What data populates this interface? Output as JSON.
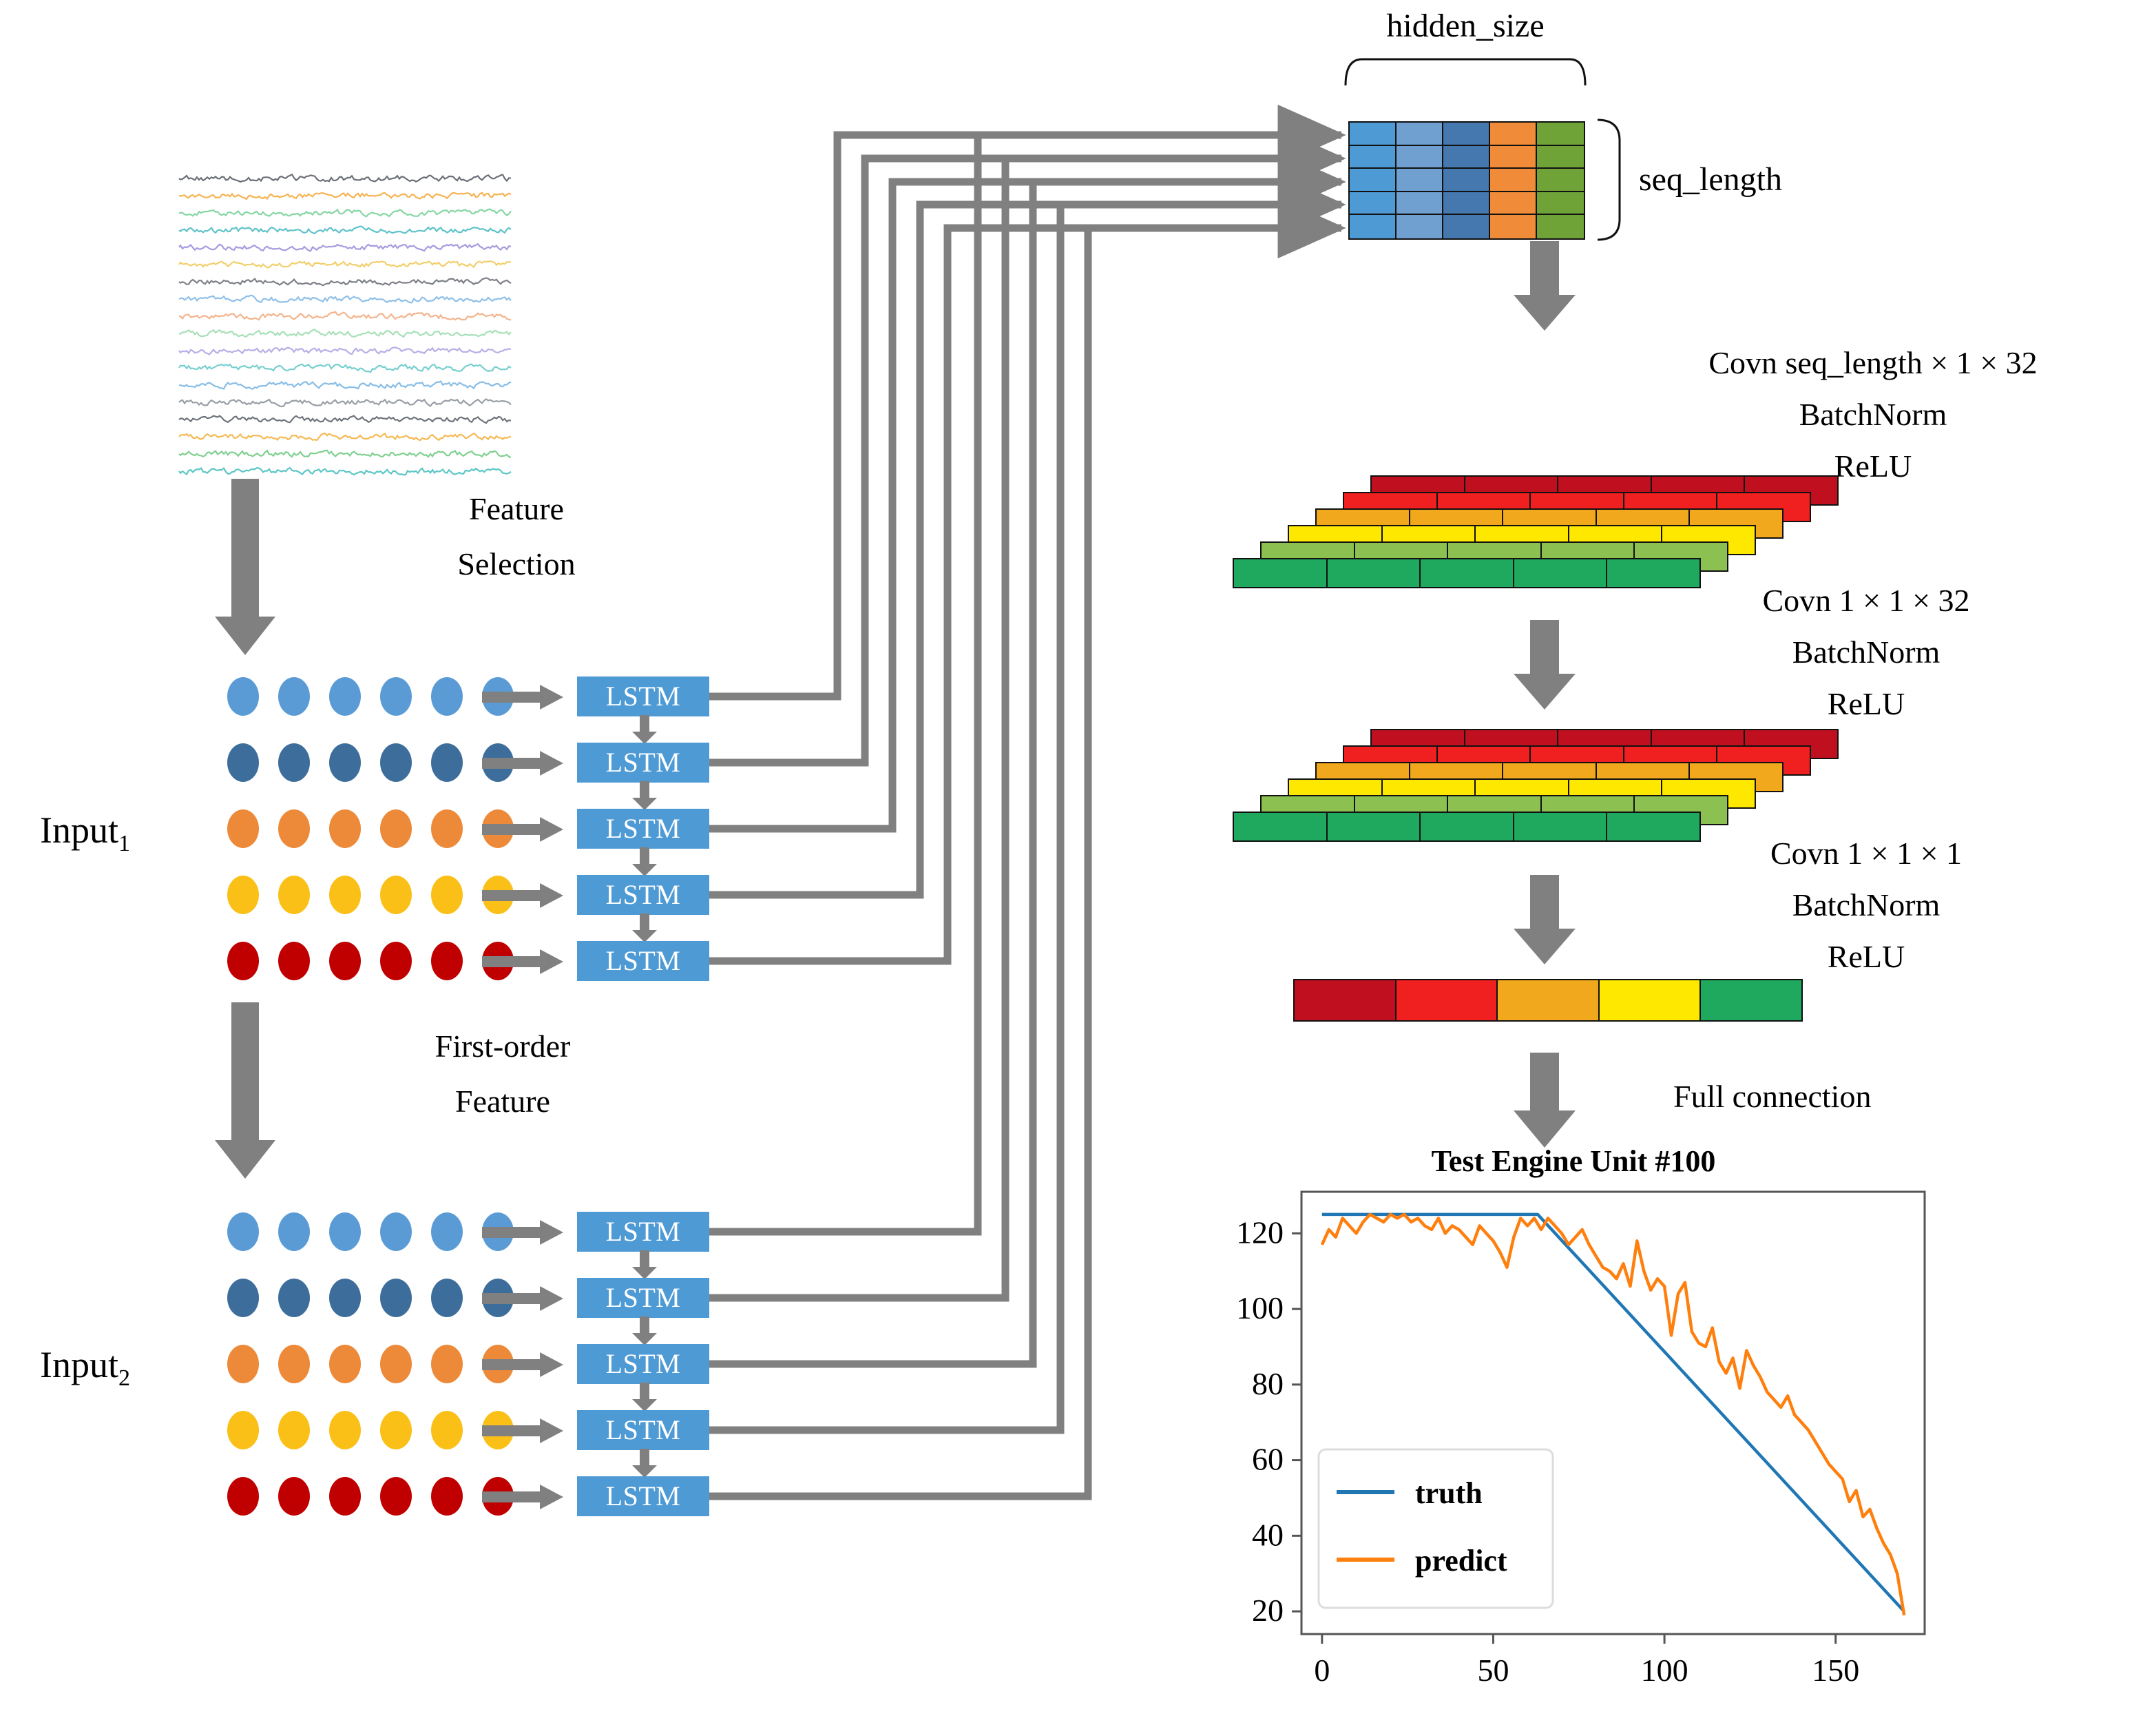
{
  "labels": {
    "hidden_size": "hidden_size",
    "seq_length": "seq_length",
    "feature_selection_l1": "Feature",
    "feature_selection_l2": "Selection",
    "first_order_l1": "First-order",
    "first_order_l2": "Feature",
    "input1": "Input",
    "input1_sub": "1",
    "input2": "Input",
    "input2_sub": "2",
    "lstm": "LSTM",
    "full_connection": "Full connection"
  },
  "blocks": {
    "conv1": {
      "line1": "Covn seq_length × 1  × 32",
      "line2": "BatchNorm",
      "line3": "ReLU"
    },
    "conv2": {
      "line1": "Covn 1 × 1 × 32",
      "line2": "BatchNorm",
      "line3": "ReLU"
    },
    "conv3": {
      "line1": "Covn 1 × 1 × 1",
      "line2": "BatchNorm",
      "line3": "ReLU"
    }
  },
  "colors": {
    "lstm_fill": "#4E9AD5",
    "arrow_gray": "#808080",
    "matrix_columns": [
      "#4E9AD5",
      "#6FA0D0",
      "#4478AE",
      "#F08C39",
      "#6FA338"
    ],
    "dot_rows": [
      "#5B9BD5",
      "#3D6E9B",
      "#ED8A3A",
      "#FBC018",
      "#C00000"
    ],
    "stack_layers": [
      "#1FA95E",
      "#8CC152",
      "#FFE800",
      "#F2A81D",
      "#F02020",
      "#C01020"
    ],
    "final_vector": [
      "#C01020",
      "#F02020",
      "#F2A81D",
      "#FFE800",
      "#1FA95E"
    ],
    "truth_line": "#2077B4",
    "predict_line": "#FF7F0E"
  },
  "matrix": {
    "rows": 5,
    "cols": 5
  },
  "stacks": {
    "layers": 6,
    "cells_per_layer": 5
  },
  "chart_data": {
    "type": "line",
    "title": "Test Engine Unit #100",
    "xlabel": "",
    "ylabel": "",
    "xlim": [
      -6,
      176
    ],
    "ylim": [
      14,
      131
    ],
    "xticks": [
      0,
      50,
      100,
      150
    ],
    "yticks": [
      20,
      40,
      60,
      80,
      100,
      120
    ],
    "grid": false,
    "legend_position": "lower left",
    "legend": [
      "truth",
      "predict"
    ],
    "series": [
      {
        "name": "truth",
        "color": "#2077B4",
        "x": [
          0,
          63,
          170
        ],
        "y": [
          125,
          125,
          20
        ]
      },
      {
        "name": "predict",
        "color": "#FF7F0E",
        "x": [
          0,
          2,
          4,
          6,
          8,
          10,
          12,
          14,
          16,
          18,
          20,
          22,
          24,
          26,
          28,
          30,
          32,
          34,
          36,
          38,
          40,
          42,
          44,
          46,
          48,
          50,
          52,
          54,
          56,
          58,
          60,
          62,
          64,
          66,
          68,
          70,
          72,
          74,
          76,
          78,
          80,
          82,
          84,
          86,
          88,
          90,
          92,
          94,
          96,
          98,
          100,
          102,
          104,
          106,
          108,
          110,
          112,
          114,
          116,
          118,
          120,
          122,
          124,
          126,
          128,
          130,
          132,
          134,
          136,
          138,
          140,
          142,
          144,
          146,
          148,
          150,
          152,
          154,
          156,
          158,
          160,
          162,
          164,
          166,
          168,
          170
        ],
        "y": [
          117,
          121,
          119,
          124,
          122,
          120,
          123,
          125,
          124,
          123,
          125,
          124,
          125,
          123,
          124,
          122,
          121,
          124,
          120,
          122,
          121,
          119,
          117,
          122,
          120,
          118,
          115,
          111,
          119,
          124,
          122,
          124,
          121,
          124,
          122,
          120,
          117,
          119,
          121,
          117,
          114,
          111,
          110,
          108,
          112,
          106,
          118,
          110,
          105,
          108,
          106,
          93,
          104,
          107,
          94,
          91,
          90,
          95,
          86,
          83,
          87,
          79,
          89,
          85,
          82,
          78,
          76,
          74,
          77,
          72,
          70,
          68,
          65,
          62,
          59,
          57,
          55,
          49,
          52,
          45,
          47,
          42,
          38,
          35,
          30,
          19
        ]
      }
    ]
  }
}
